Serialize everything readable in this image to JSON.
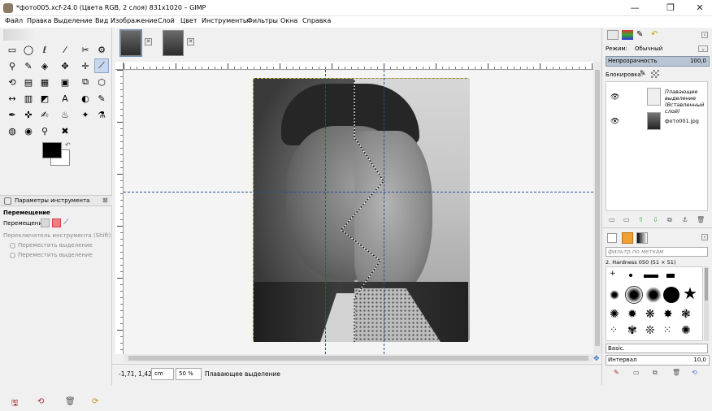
{
  "window": {
    "title": "*фото005.xcf-24.0 (Цвета RGB, 2 слоя) 831x1020 – GIMP",
    "minimize": "—",
    "maximize": "❐",
    "close": "✕"
  },
  "menu": [
    "Файл",
    "Правка",
    "Выделение",
    "Вид",
    "Изображение",
    "Слой",
    "Цвет",
    "Инструменты",
    "Фильтры",
    "Окна",
    "Справка"
  ],
  "toolbox": {
    "tools": [
      "▭",
      "◯",
      "ℓ",
      "⁄",
      "✂",
      "⚙",
      "⚲",
      "✎",
      "◈",
      "✥",
      "✛",
      "⟋",
      "⟲",
      "▤",
      "▦",
      "▣",
      "⧉",
      "⬡",
      "↔",
      "▥",
      "◩",
      "✐",
      "A",
      "◐",
      "✎",
      "✒",
      "✜",
      "✍",
      "♨",
      "✦",
      "⚗",
      "◍",
      "◉",
      "⚲",
      "✖"
    ],
    "options_title": "Параметры инструмента",
    "move_label": "Перемещение",
    "move_row_label": "Перемещение:",
    "switch_label": "Переключатель инструмента  (Shift)",
    "radio1": "Переместить выделение",
    "radio2": "Переместить выделение",
    "bottom_icons": [
      "🖫",
      "⟲",
      "🗑",
      "⟳"
    ]
  },
  "tabs": {
    "close1": "✕",
    "close2": "✕"
  },
  "status": {
    "coords": "-1,71, 1,42",
    "unit": "cm",
    "zoom": "50 %",
    "message": "Плавающее выделение"
  },
  "right_panel": {
    "mode_label": "Режим:",
    "mode_value": "Обычный",
    "opacity_label": "Непрозрачность",
    "opacity_value": "100,0",
    "lock_label": "Блокировка:",
    "layers": [
      {
        "name": "Плавающее выделение (Вставленный слой)",
        "visible": "👁"
      },
      {
        "name": "фото001.jpg",
        "visible": "👁"
      }
    ],
    "layer_buttons": [
      "▭",
      "▭",
      "⇧",
      "⇩",
      "⧉",
      "⚓",
      "🗑"
    ],
    "brush_filter_placeholder": "фильтр по меткам",
    "brush_name": "2. Hardness 050 (51 × 51)",
    "preset": "Basic.",
    "spacing_label": "Интервал",
    "spacing_value": "10,0",
    "bottom_buttons": [
      "✎",
      "▭",
      "⧉",
      "🗑",
      "⟲"
    ]
  }
}
